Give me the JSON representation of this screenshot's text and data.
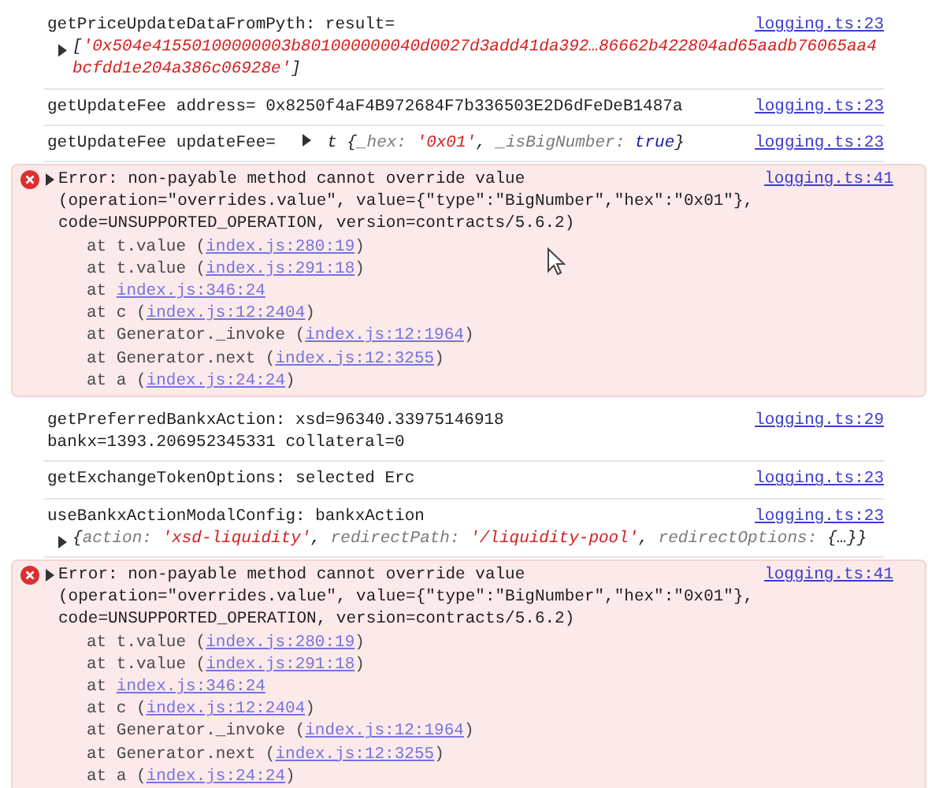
{
  "messages": [
    {
      "kind": "log",
      "text": "getPriceUpdateDataFromPyth: result=",
      "source": "logging.ts:23",
      "preview": {
        "inline": false,
        "expanded": false,
        "tokens": [
          {
            "kind": "punct",
            "text": "["
          },
          {
            "kind": "string",
            "text": "'0x504e41550100000003b801000000040d0027d3add41da392…86662b422804ad65aadb76065aa4bcfdd1e204a386c06928e'"
          },
          {
            "kind": "punct",
            "text": "]"
          }
        ]
      }
    },
    {
      "kind": "log",
      "text": "getUpdateFee address= 0x8250f4aF4B972684F7b336503E2D6dFeDeB1487a",
      "source": "logging.ts:23"
    },
    {
      "kind": "log",
      "text": "getUpdateFee updateFee=",
      "source": "logging.ts:23",
      "preview": {
        "inline": true,
        "expanded": false,
        "tokens": [
          {
            "kind": "punct",
            "text": "t {"
          },
          {
            "kind": "key",
            "text": "_hex: "
          },
          {
            "kind": "string",
            "text": "'0x01'"
          },
          {
            "kind": "punct",
            "text": ", "
          },
          {
            "kind": "key",
            "text": "_isBigNumber: "
          },
          {
            "kind": "bool",
            "text": "true"
          },
          {
            "kind": "punct",
            "text": "}"
          }
        ]
      }
    },
    {
      "kind": "error",
      "expanded": false,
      "text": "Error: non-payable method cannot override value (operation=\"overrides.value\", value={\"type\":\"BigNumber\",\"hex\":\"0x01\"}, code=UNSUPPORTED_OPERATION, version=contracts/5.6.2)",
      "source": "logging.ts:41",
      "stack": [
        {
          "before": "at t.value (",
          "link": "index.js:280:19",
          "after": ")"
        },
        {
          "before": "at t.value (",
          "link": "index.js:291:18",
          "after": ")"
        },
        {
          "before": "at ",
          "link": "index.js:346:24"
        },
        {
          "before": "at c (",
          "link": "index.js:12:2404",
          "after": ")"
        },
        {
          "before": "at Generator._invoke (",
          "link": "index.js:12:1964",
          "after": ")"
        },
        {
          "before": "at Generator.next (",
          "link": "index.js:12:3255",
          "after": ")"
        },
        {
          "before": "at a (",
          "link": "index.js:24:24",
          "after": ")"
        }
      ]
    },
    {
      "kind": "log",
      "text": "getPreferredBankxAction: xsd=96340.33975146918\nbankx=1393.206952345331 collateral=0",
      "source": "logging.ts:29"
    },
    {
      "kind": "log",
      "text": "getExchangeTokenOptions: selected Erc",
      "source": "logging.ts:23"
    },
    {
      "kind": "log",
      "text": "useBankxActionModalConfig: bankxAction",
      "source": "logging.ts:23",
      "preview": {
        "inline": false,
        "expanded": false,
        "tokens": [
          {
            "kind": "punct",
            "text": "{"
          },
          {
            "kind": "key",
            "text": "action: "
          },
          {
            "kind": "string",
            "text": "'xsd-liquidity'"
          },
          {
            "kind": "punct",
            "text": ", "
          },
          {
            "kind": "key",
            "text": "redirectPath: "
          },
          {
            "kind": "string",
            "text": "'/liquidity-pool'"
          },
          {
            "kind": "punct",
            "text": ", "
          },
          {
            "kind": "key",
            "text": "redirectOptions: "
          },
          {
            "kind": "punct",
            "text": "{…}}"
          }
        ]
      }
    },
    {
      "kind": "error",
      "expanded": false,
      "text": "Error: non-payable method cannot override value (operation=\"overrides.value\", value={\"type\":\"BigNumber\",\"hex\":\"0x01\"}, code=UNSUPPORTED_OPERATION, version=contracts/5.6.2)",
      "source": "logging.ts:41",
      "stack": [
        {
          "before": "at t.value (",
          "link": "index.js:280:19",
          "after": ")"
        },
        {
          "before": "at t.value (",
          "link": "index.js:291:18",
          "after": ")"
        },
        {
          "before": "at ",
          "link": "index.js:346:24"
        },
        {
          "before": "at c (",
          "link": "index.js:12:2404",
          "after": ")"
        },
        {
          "before": "at Generator._invoke (",
          "link": "index.js:12:1964",
          "after": ")"
        },
        {
          "before": "at Generator.next (",
          "link": "index.js:12:3255",
          "after": ")"
        },
        {
          "before": "at a (",
          "link": "index.js:24:24",
          "after": ")"
        }
      ]
    }
  ]
}
